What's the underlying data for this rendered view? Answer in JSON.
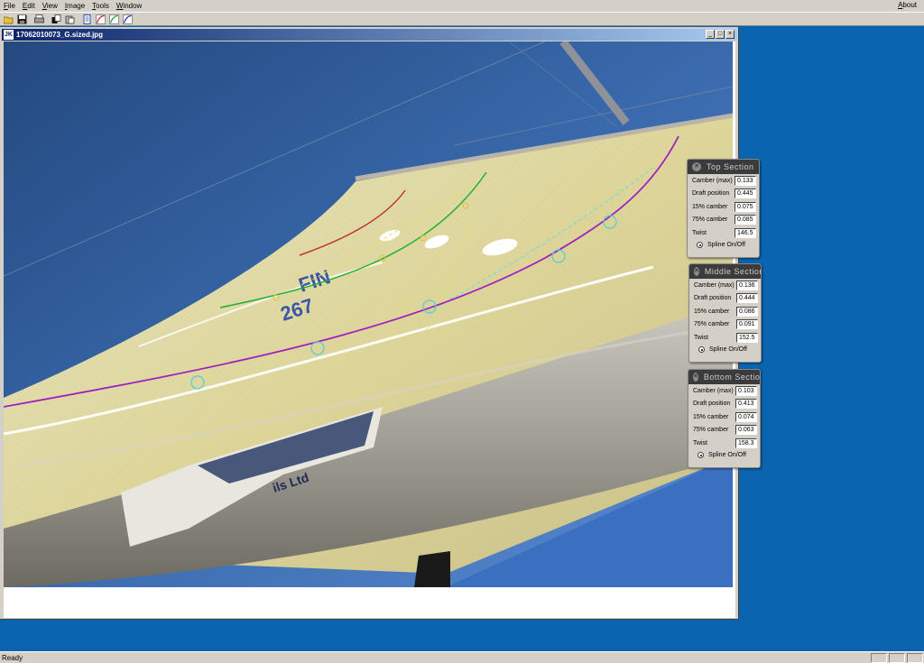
{
  "menu": {
    "items": [
      "File",
      "Edit",
      "View",
      "Image",
      "Tools",
      "Window"
    ],
    "about": "About"
  },
  "toolbar": {
    "buttons": [
      "open-icon",
      "save-icon",
      "print-icon",
      "copy-icon",
      "paste-icon",
      "document-icon",
      "red-curve-icon",
      "green-curve-icon",
      "blue-curve-icon"
    ]
  },
  "window": {
    "title": "17062010073_G.sized.jpg",
    "icon_text": "JK"
  },
  "panels": [
    {
      "title": "Top Section",
      "rows": [
        {
          "label": "Camber (max)",
          "value": "0.133"
        },
        {
          "label": "Draft position",
          "value": "0.445"
        },
        {
          "label": "15% camber",
          "value": "0.075"
        },
        {
          "label": "75% camber",
          "value": "0.085"
        },
        {
          "label": "Twist",
          "value": "146.5"
        }
      ],
      "spline": "Spline On/Off"
    },
    {
      "title": "Middle Section",
      "rows": [
        {
          "label": "Camber (max)",
          "value": "0.136"
        },
        {
          "label": "Draft position",
          "value": "0.444"
        },
        {
          "label": "15% camber",
          "value": "0.086"
        },
        {
          "label": "75% camber",
          "value": "0.091"
        },
        {
          "label": "Twist",
          "value": "152.5"
        }
      ],
      "spline": "Spline On/Off"
    },
    {
      "title": "Bottom Section",
      "rows": [
        {
          "label": "Camber (max)",
          "value": "0.103"
        },
        {
          "label": "Draft position",
          "value": "0.413"
        },
        {
          "label": "15% camber",
          "value": "0.074"
        },
        {
          "label": "75% camber",
          "value": "0.063"
        },
        {
          "label": "Twist",
          "value": "158.3"
        }
      ],
      "spline": "Spline On/Off"
    }
  ],
  "photo": {
    "sail_text_1": "FIN",
    "sail_text_2": "267",
    "boom_text": "ils Ltd"
  },
  "colors": {
    "mdi_background": "#0a64b0",
    "sky": "#3a6aad",
    "sail": "#ddd8a8",
    "top_spline": "#c0303a",
    "middle_spline": "#22b030",
    "bottom_spline": "#a020c0"
  },
  "status": {
    "text": "Ready"
  }
}
